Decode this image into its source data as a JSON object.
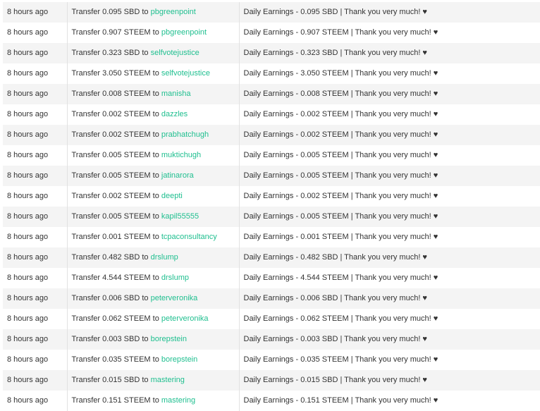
{
  "colors": {
    "account_link": "#1fbf8f",
    "stripe": "#f4f4f4",
    "text": "#333333"
  },
  "transfers": [
    {
      "time": "8 hours ago",
      "prefix": "Transfer 0.095 SBD to",
      "account": "pbgreenpoint",
      "memo": "Daily Earnings - 0.095 SBD | Thank you very much! ♥"
    },
    {
      "time": "8 hours ago",
      "prefix": "Transfer 0.907 STEEM to",
      "account": "pbgreenpoint",
      "memo": "Daily Earnings - 0.907 STEEM | Thank you very much! ♥"
    },
    {
      "time": "8 hours ago",
      "prefix": "Transfer 0.323 SBD to",
      "account": "selfvotejustice",
      "memo": "Daily Earnings - 0.323 SBD | Thank you very much! ♥"
    },
    {
      "time": "8 hours ago",
      "prefix": "Transfer 3.050 STEEM to",
      "account": "selfvotejustice",
      "memo": "Daily Earnings - 3.050 STEEM | Thank you very much! ♥"
    },
    {
      "time": "8 hours ago",
      "prefix": "Transfer 0.008 STEEM to",
      "account": "manisha",
      "memo": "Daily Earnings - 0.008 STEEM | Thank you very much! ♥"
    },
    {
      "time": "8 hours ago",
      "prefix": "Transfer 0.002 STEEM to",
      "account": "dazzles",
      "memo": "Daily Earnings - 0.002 STEEM | Thank you very much! ♥"
    },
    {
      "time": "8 hours ago",
      "prefix": "Transfer 0.002 STEEM to",
      "account": "prabhatchugh",
      "memo": "Daily Earnings - 0.002 STEEM | Thank you very much! ♥"
    },
    {
      "time": "8 hours ago",
      "prefix": "Transfer 0.005 STEEM to",
      "account": "muktichugh",
      "memo": "Daily Earnings - 0.005 STEEM | Thank you very much! ♥"
    },
    {
      "time": "8 hours ago",
      "prefix": "Transfer 0.005 STEEM to",
      "account": "jatinarora",
      "memo": "Daily Earnings - 0.005 STEEM | Thank you very much! ♥"
    },
    {
      "time": "8 hours ago",
      "prefix": "Transfer 0.002 STEEM to",
      "account": "deepti",
      "memo": "Daily Earnings - 0.002 STEEM | Thank you very much! ♥"
    },
    {
      "time": "8 hours ago",
      "prefix": "Transfer 0.005 STEEM to",
      "account": "kapil55555",
      "memo": "Daily Earnings - 0.005 STEEM | Thank you very much! ♥"
    },
    {
      "time": "8 hours ago",
      "prefix": "Transfer 0.001 STEEM to",
      "account": "tcpaconsultancy",
      "memo": "Daily Earnings - 0.001 STEEM | Thank you very much! ♥"
    },
    {
      "time": "8 hours ago",
      "prefix": "Transfer 0.482 SBD to",
      "account": "drslump",
      "memo": "Daily Earnings - 0.482 SBD | Thank you very much! ♥"
    },
    {
      "time": "8 hours ago",
      "prefix": "Transfer 4.544 STEEM to",
      "account": "drslump",
      "memo": "Daily Earnings - 4.544 STEEM | Thank you very much! ♥"
    },
    {
      "time": "8 hours ago",
      "prefix": "Transfer 0.006 SBD to",
      "account": "peterveronika",
      "memo": "Daily Earnings - 0.006 SBD | Thank you very much! ♥"
    },
    {
      "time": "8 hours ago",
      "prefix": "Transfer 0.062 STEEM to",
      "account": "peterveronika",
      "memo": "Daily Earnings - 0.062 STEEM | Thank you very much! ♥"
    },
    {
      "time": "8 hours ago",
      "prefix": "Transfer 0.003 SBD to",
      "account": "borepstein",
      "memo": "Daily Earnings - 0.003 SBD | Thank you very much! ♥"
    },
    {
      "time": "8 hours ago",
      "prefix": "Transfer 0.035 STEEM to",
      "account": "borepstein",
      "memo": "Daily Earnings - 0.035 STEEM | Thank you very much! ♥"
    },
    {
      "time": "8 hours ago",
      "prefix": "Transfer 0.015 SBD to",
      "account": "mastering",
      "memo": "Daily Earnings - 0.015 SBD | Thank you very much! ♥"
    },
    {
      "time": "8 hours ago",
      "prefix": "Transfer 0.151 STEEM to",
      "account": "mastering",
      "memo": "Daily Earnings - 0.151 STEEM | Thank you very much! ♥"
    }
  ]
}
